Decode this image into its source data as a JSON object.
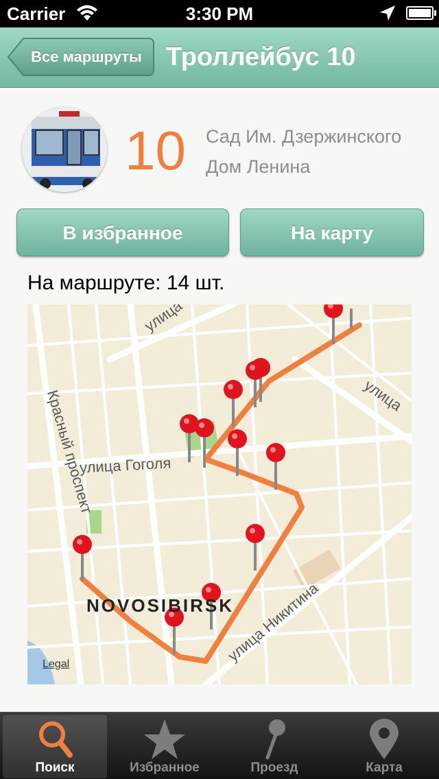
{
  "status_bar": {
    "carrier": "Carrier",
    "time": "3:30 PM"
  },
  "nav": {
    "back_label": "Все маршруты",
    "title": "Троллейбус 10"
  },
  "route": {
    "number": "10",
    "stop_from": "Сад Им. Дзержинского",
    "stop_to": "Дом Ленина",
    "number_color": "#f07e3c"
  },
  "buttons": {
    "favorite": "В избранное",
    "on_map": "На карту"
  },
  "on_route_text": "На маршруте: 14 шт.",
  "map": {
    "labels": {
      "gogol": "улица Гоголя",
      "krasny": "Красный проспект",
      "ulica_top": "улица",
      "ulica_right": "улица",
      "nikitina": "улица Никитина",
      "city": "NOVOSIBIRSK",
      "legal": "Legal"
    },
    "route_color": "#f08040",
    "pin_color": "#e0141e"
  },
  "tabs": [
    {
      "label": "Поиск",
      "icon": "search-icon",
      "active": true
    },
    {
      "label": "Избранное",
      "icon": "star-icon",
      "active": false
    },
    {
      "label": "Проезд",
      "icon": "pin-icon",
      "active": false
    },
    {
      "label": "Карта",
      "icon": "map-pin-icon",
      "active": false
    }
  ]
}
